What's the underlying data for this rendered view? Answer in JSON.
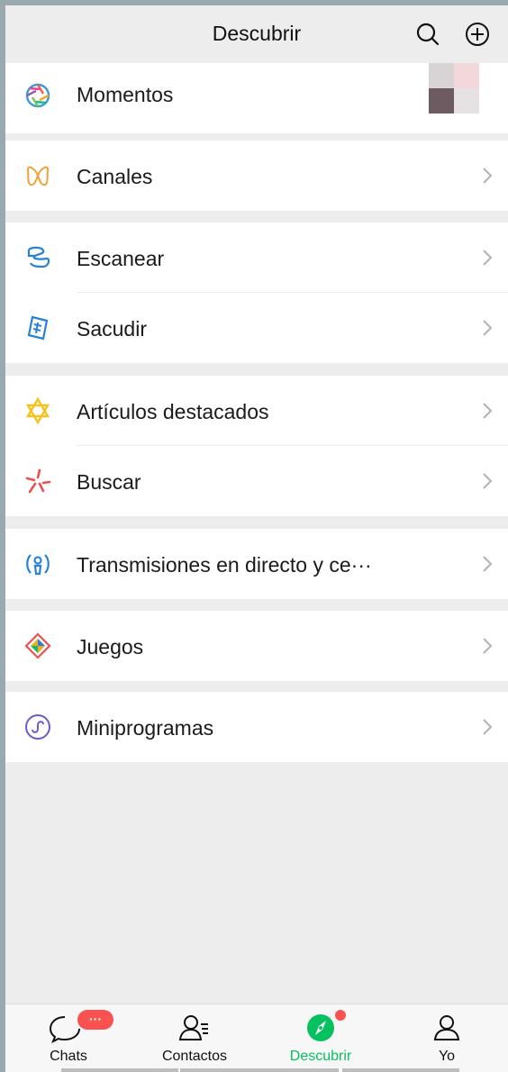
{
  "header": {
    "title": "Descubrir"
  },
  "menu": {
    "moments": "Momentos",
    "channels": "Canales",
    "scan": "Escanear",
    "shake": "Sacudir",
    "top_stories": "Artículos destacados",
    "search": "Buscar",
    "live": "Transmisiones en directo y ce···",
    "games": "Juegos",
    "mini_programs": "Miniprogramas"
  },
  "tabbar": {
    "chats": "Chats",
    "chats_badge": "···",
    "contacts": "Contactos",
    "discover": "Descubrir",
    "me": "Yo"
  },
  "colors": {
    "accent": "#07c160",
    "badge": "#fa5151",
    "background": "#ededed"
  },
  "icons": {
    "moments": "aperture-icon",
    "channels": "butterfly-icon",
    "scan": "scan-icon",
    "shake": "shake-icon",
    "top_stories": "star-of-david-icon",
    "search": "search-spark-icon",
    "live": "broadcast-icon",
    "games": "diamond-game-icon",
    "mini_programs": "mini-program-icon"
  }
}
